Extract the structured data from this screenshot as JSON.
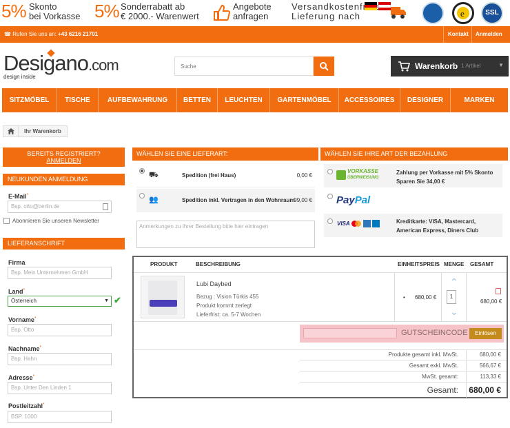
{
  "promo": {
    "item1_pct": "5%",
    "item1_line1": "Skonto",
    "item1_line2": "bei Vorkasse",
    "item2_pct": "5%",
    "item2_line1": "Sonderrabatt ab",
    "item2_line2": "€ 2000.- Warenwert",
    "item3_line1": "Angebote",
    "item3_line2": "anfragen",
    "item4_line1": "Versandkostenfreie",
    "item4_line2": "Lieferung nach",
    "badge_ssl": "SSL"
  },
  "topbar": {
    "phone_label": "Rufen Sie uns an:",
    "phone_number": "+43 6216 21701",
    "contact": "Kontakt",
    "login": "Anmelden"
  },
  "header": {
    "logo_main": "Desigano",
    "logo_com": ".com",
    "logo_sub": "design inside",
    "search_placeholder": "Suche",
    "cart_label": "Warenkorb",
    "cart_count": "1 Artikel"
  },
  "nav": [
    "SITZMÖBEL",
    "TISCHE",
    "AUFBEWAHRUNG",
    "BETTEN",
    "LEUCHTEN",
    "GARTENMÖBEL",
    "ACCESSOIRES",
    "DESIGNER",
    "MARKEN"
  ],
  "breadcrumb": {
    "current": "Ihr Warenkorb"
  },
  "left": {
    "registered_line1": "BEREITS REGISTRIERT?",
    "registered_line2": "ANMELDEN",
    "new_login": "NEUKUNDEN ANMELDUNG",
    "email_label": "E-Mail",
    "email_placeholder": "Bsp. otto@berlin.de",
    "newsletter": "Abonnieren Sie unseren Newsletter",
    "delivery_header": "LIEFERANSCHRIFT",
    "firma_label": "Firma",
    "firma_placeholder": "Bsp. Mein Unternehmen GmbH",
    "land_label": "Land",
    "land_value": "Österreich",
    "vorname_label": "Vorname",
    "vorname_placeholder": "Bsp. Otto",
    "nachname_label": "Nachname",
    "nachname_placeholder": "Bsp. Hahn",
    "adresse_label": "Adresse",
    "adresse_placeholder": "Bsp. Unter Den Linden 1",
    "plz_label": "Postleitzahl",
    "plz_placeholder": "BSP. 1000",
    "req": "*"
  },
  "shipping": {
    "header": "WÄHLEN SIE EINE LIEFERART:",
    "options": [
      {
        "name": "Spedition (frei Haus)",
        "price": "0,00 €"
      },
      {
        "name": "Spedition inkl. Vertragen in den Wohnraum",
        "price": "99,00 €"
      }
    ],
    "notes_placeholder": "Anmerkungen zu Ihrer Bestellung bitte hier eintragen"
  },
  "payment": {
    "header": "WÄHLEN SIE IHRE ART DER BEZAHLUNG",
    "vorkasse_logo_top": "VORKASSE",
    "vorkasse_logo_bottom": "ÜBERWEISUNG",
    "vorkasse_line1": "Zahlung per Vorkasse mit 5% Skonto",
    "vorkasse_line2": "Sparen Sie 34,00 €",
    "paypal_pay": "Pay",
    "paypal_pal": "Pal",
    "card_line1": "Kreditkarte: VISA, Mastercard,",
    "card_line2": "American Express, Diners Club",
    "visa": "VISA"
  },
  "cart": {
    "col_product": "PRODUKT",
    "col_desc": "BESCHREIBUNG",
    "col_unit": "EINHEITSPREIS",
    "col_qty": "MENGE",
    "col_total": "GESAMT",
    "item_name": "Lubi Daybed",
    "item_cover": "Bezug : Vision Türkis 455",
    "item_assembly": "Produkt kommt zerlegt",
    "item_delivery": "Lieferfrist: ca. 5-7 Wochen",
    "item_unit_price": "680,00 €",
    "item_qty": "1",
    "item_total": "680,00 €",
    "voucher_label": "GUTSCHEINCODE",
    "voucher_button": "Einlösen",
    "sum_gross_label": "Produkte gesamt inkl. MwSt.",
    "sum_gross": "680,00 €",
    "sum_net_label": "Gesamt exkl. MwSt.",
    "sum_net": "566,67 €",
    "vat_label": "MwSt. gesamt:",
    "vat": "113,33 €",
    "total_label": "Gesamt:",
    "total": "680,00 €"
  },
  "colors": {
    "accent": "#f26d0f",
    "dark": "#333333",
    "voucher_bg": "#f6c3c9",
    "voucher_btn": "#c58a1c"
  }
}
